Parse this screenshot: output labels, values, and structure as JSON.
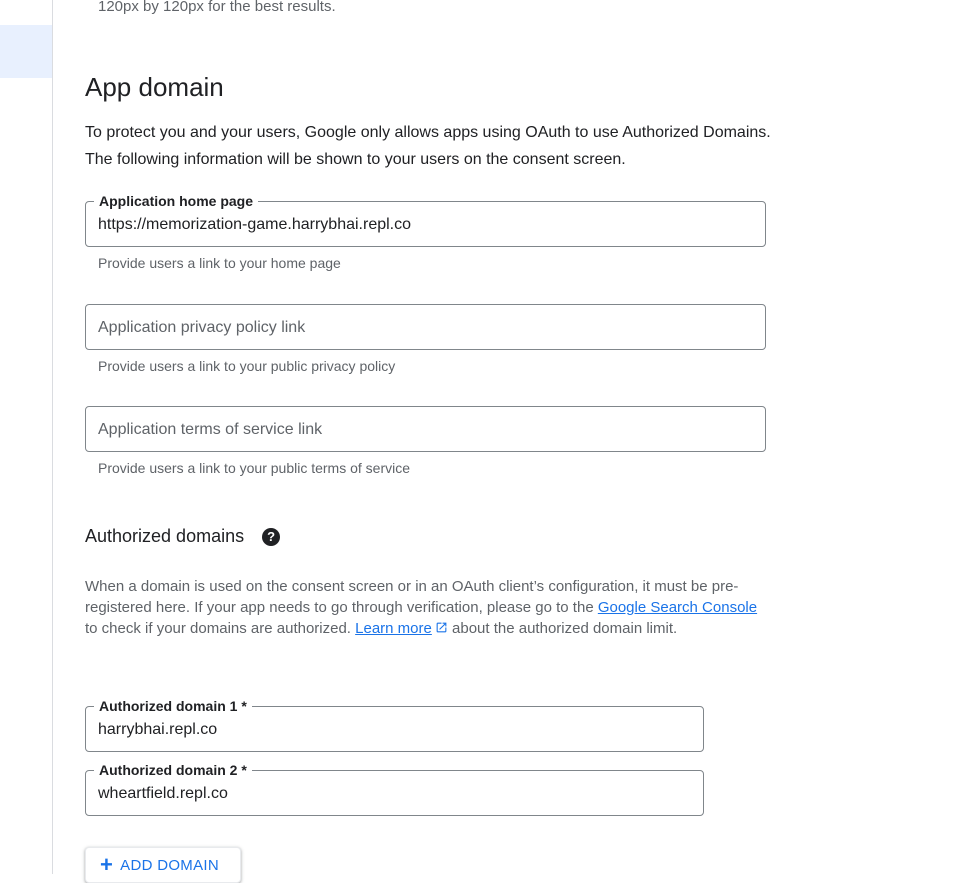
{
  "top_hint": "120px by 120px for the best results.",
  "app_domain": {
    "title": "App domain",
    "description": "To protect you and your users, Google only allows apps using OAuth to use Authorized Domains. The following information will be shown to your users on the consent screen.",
    "home_page": {
      "label": "Application home page",
      "value": "https://memorization-game.harrybhai.repl.co",
      "helper": "Provide users a link to your home page"
    },
    "privacy_policy": {
      "placeholder": "Application privacy policy link",
      "helper": "Provide users a link to your public privacy policy"
    },
    "terms_of_service": {
      "placeholder": "Application terms of service link",
      "helper": "Provide users a link to your public terms of service"
    }
  },
  "authorized_domains": {
    "title": "Authorized domains",
    "help_icon": "help-circle-icon",
    "desc_part1": "When a domain is used on the consent screen or in an OAuth client’s configuration, it must be pre-registered here. If your app needs to go through verification, please go to the ",
    "search_console_link": "Google Search Console ",
    "desc_part2": "to check if your domains are authorized. ",
    "learn_more_link": "Learn more",
    "desc_part3": " about the authorized domain limit.",
    "domains": [
      {
        "label": "Authorized domain 1 *",
        "value": "harrybhai.repl.co"
      },
      {
        "label": "Authorized domain 2 *",
        "value": "wheartfield.repl.co"
      }
    ],
    "add_button": "ADD DOMAIN"
  },
  "colors": {
    "link": "#1a73e8",
    "border": "#80868b",
    "active_rail": "#e8f0fe"
  }
}
